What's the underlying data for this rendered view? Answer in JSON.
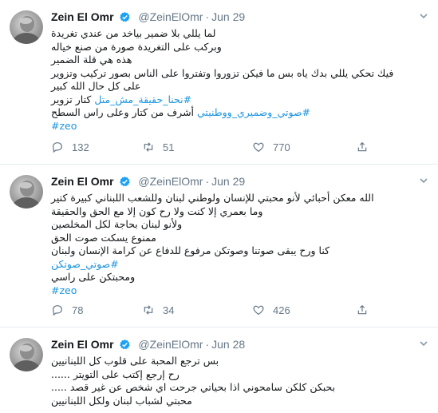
{
  "tweets": [
    {
      "author": "Zein El Omr",
      "handle": "@ZeinElOmr",
      "date": "Jun 29",
      "lines": [
        {
          "text": "لما يللي بلا ضمير بياخد من عندي تغريدة",
          "tag": false
        },
        {
          "text": "وبركب على التغريدة صورة من صنع خياله",
          "tag": false
        },
        {
          "text": "هذه هي قلة الضمير",
          "tag": false
        },
        {
          "text": "فيك تحكي يللي بدك ياه بس ما فيكن تزوروا وتفتروا على الناس بصور تركيب وتزوير",
          "tag": false
        },
        {
          "text": "على كل حال الله كبير",
          "tag": false
        },
        {
          "text": "#نحنا_حقيقة_مش_متل كتار تزوير",
          "tag": "partial"
        },
        {
          "text": "#صوتي_وضميري_ووطنيتي أشرف من كتار وعلى راس السطح",
          "tag": "partial"
        },
        {
          "text": "#zeo",
          "tag": true
        }
      ],
      "replies": "132",
      "retweets": "51",
      "likes": "770"
    },
    {
      "author": "Zein El Omr",
      "handle": "@ZeinElOmr",
      "date": "Jun 29",
      "lines": [
        {
          "text": "الله معكن أحبائي لأنو محبتي للإنسان ولوطني لبنان وللشعب اللبناني كبيرة كتير",
          "tag": false
        },
        {
          "text": "وما بعمري إلا كنت ولا رح كون إلا مع الحق والحقيقة",
          "tag": false
        },
        {
          "text": "ولأنو لبنان بحاجة لكل المخلصين",
          "tag": false
        },
        {
          "text": "ممنوع يسكت صوت الحق",
          "tag": false
        },
        {
          "text": "كنا ورح يبقى صوتنا وصوتكن مرفوع للدفاع عن كرامة الإنسان ولبنان",
          "tag": false
        },
        {
          "text": "#صوتي_صوتكن",
          "tag": true
        },
        {
          "text": "ومحبتكن على راسي",
          "tag": false
        },
        {
          "text": "#zeo",
          "tag": true
        }
      ],
      "replies": "78",
      "retweets": "34",
      "likes": "426"
    },
    {
      "author": "Zein El Omr",
      "handle": "@ZeinElOmr",
      "date": "Jun 28",
      "lines": [
        {
          "text": "بس ترجع المحبة على قلوب كل اللبنانيين",
          "tag": false
        },
        {
          "text": "رح إرجع إكتب على التويتر ......",
          "tag": false
        },
        {
          "text": "بحبكن كلكن سامحوني اذا بحياتي جرحت اي شخص عن غير قصد .....",
          "tag": false
        },
        {
          "text": "محبتي لشباب لبنان ولكل اللبنانيين",
          "tag": false
        }
      ],
      "replies": "",
      "retweets": "",
      "likes": ""
    }
  ],
  "icons": {
    "reply": "reply-icon",
    "retweet": "retweet-icon",
    "like": "heart-icon",
    "verified": "verified-badge-icon",
    "menu": "chevron-down-icon"
  },
  "colors": {
    "hashtag": "#1b95e0",
    "verified": "#1da1f2",
    "muted": "#657786",
    "divider": "#e6ecf0"
  }
}
